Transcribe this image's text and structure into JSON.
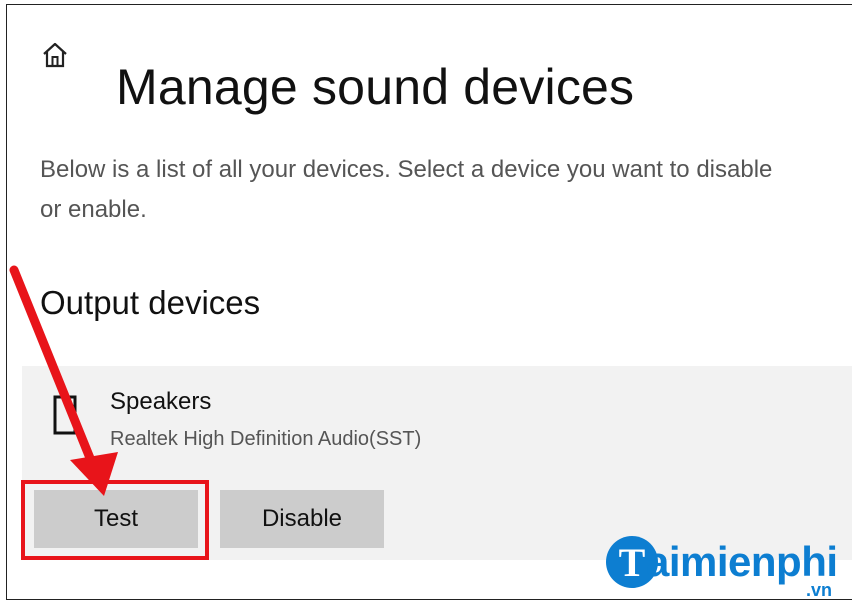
{
  "header": {
    "home_icon": "home-icon",
    "title": "Manage sound devices"
  },
  "description": "Below is a list of all your devices. Select a device you want to disable or enable.",
  "output_devices": {
    "heading": "Output devices",
    "devices": [
      {
        "icon": "speaker-icon",
        "name": "Speakers",
        "description": "Realtek High Definition Audio(SST)",
        "buttons": {
          "test_label": "Test",
          "disable_label": "Disable"
        }
      }
    ]
  },
  "annotation": {
    "arrow_color": "#e8141a",
    "highlight_color": "#e8141a"
  },
  "watermark": {
    "logo_letter": "T",
    "name": "aimienphi",
    "tld": ".vn",
    "color": "#0d7ed1"
  },
  "colors": {
    "panel_background": "#f2f2f2",
    "button_background": "#cccccc"
  }
}
